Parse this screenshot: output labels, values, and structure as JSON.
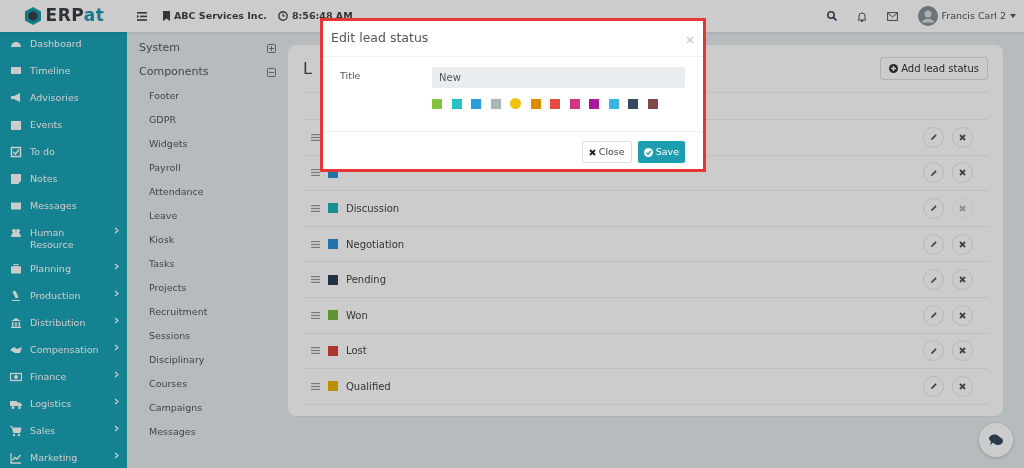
{
  "topbar": {
    "logo": {
      "dark": "ERP",
      "accent": "at"
    },
    "company": "ABC Services Inc.",
    "time": "8:56:48 AM",
    "user": "Francis Carl 2"
  },
  "sidebar": {
    "items": [
      {
        "label": "Dashboard",
        "has_children": false
      },
      {
        "label": "Timeline",
        "has_children": false
      },
      {
        "label": "Advisories",
        "has_children": false
      },
      {
        "label": "Events",
        "has_children": false
      },
      {
        "label": "To do",
        "has_children": false
      },
      {
        "label": "Notes",
        "has_children": false
      },
      {
        "label": "Messages",
        "has_children": false
      },
      {
        "label": "Human Resource",
        "has_children": true
      },
      {
        "label": "Planning",
        "has_children": true
      },
      {
        "label": "Production",
        "has_children": true
      },
      {
        "label": "Distribution",
        "has_children": true
      },
      {
        "label": "Compensation",
        "has_children": true
      },
      {
        "label": "Finance",
        "has_children": true
      },
      {
        "label": "Logistics",
        "has_children": true
      },
      {
        "label": "Sales",
        "has_children": true
      },
      {
        "label": "Marketing",
        "has_children": true
      }
    ]
  },
  "settings_menu": {
    "groups": [
      {
        "label": "System",
        "expanded": false
      },
      {
        "label": "Components",
        "expanded": true,
        "children": [
          "Footer",
          "GDPR",
          "Widgets",
          "Payroll",
          "Attendance",
          "Leave",
          "Kiosk",
          "Tasks",
          "Projects",
          "Recruitment",
          "Sessions",
          "Disciplinary",
          "Courses",
          "Campaigns",
          "Messages"
        ]
      }
    ]
  },
  "card": {
    "title": "L",
    "add_button": "Add lead status",
    "rows": [
      {
        "delete_disabled": false
      },
      {
        "color": "#2472aa",
        "delete_disabled": false
      },
      {
        "label": "Discussion",
        "color": "#1a8e8e",
        "delete_disabled": true
      },
      {
        "label": "Negotiation",
        "color": "#2472aa",
        "delete_disabled": false
      },
      {
        "label": "Pending",
        "color": "#233240",
        "delete_disabled": false
      },
      {
        "label": "Won",
        "color": "#629333",
        "delete_disabled": false
      },
      {
        "label": "Lost",
        "color": "#ae352e",
        "delete_disabled": false
      },
      {
        "label": "Qualified",
        "color": "#b89000",
        "delete_disabled": false
      }
    ]
  },
  "modal": {
    "title": "Edit lead status",
    "field_label": "Title",
    "field_value": "New",
    "colors": [
      {
        "color": "#83c340",
        "selected": false
      },
      {
        "color": "#29c2c2",
        "selected": false
      },
      {
        "color": "#2d9cdb",
        "selected": false
      },
      {
        "color": "#aab7b7",
        "selected": false
      },
      {
        "color": "#f1c40f",
        "selected": true
      },
      {
        "color": "#e18a00",
        "selected": false
      },
      {
        "color": "#e74c3c",
        "selected": false
      },
      {
        "color": "#d43480",
        "selected": false
      },
      {
        "color": "#ad159e",
        "selected": false
      },
      {
        "color": "#37b4e1",
        "selected": false
      },
      {
        "color": "#34495e",
        "selected": false
      },
      {
        "color": "#7d4a4a",
        "selected": false
      }
    ],
    "close_button": "Close",
    "save_button": "Save"
  }
}
